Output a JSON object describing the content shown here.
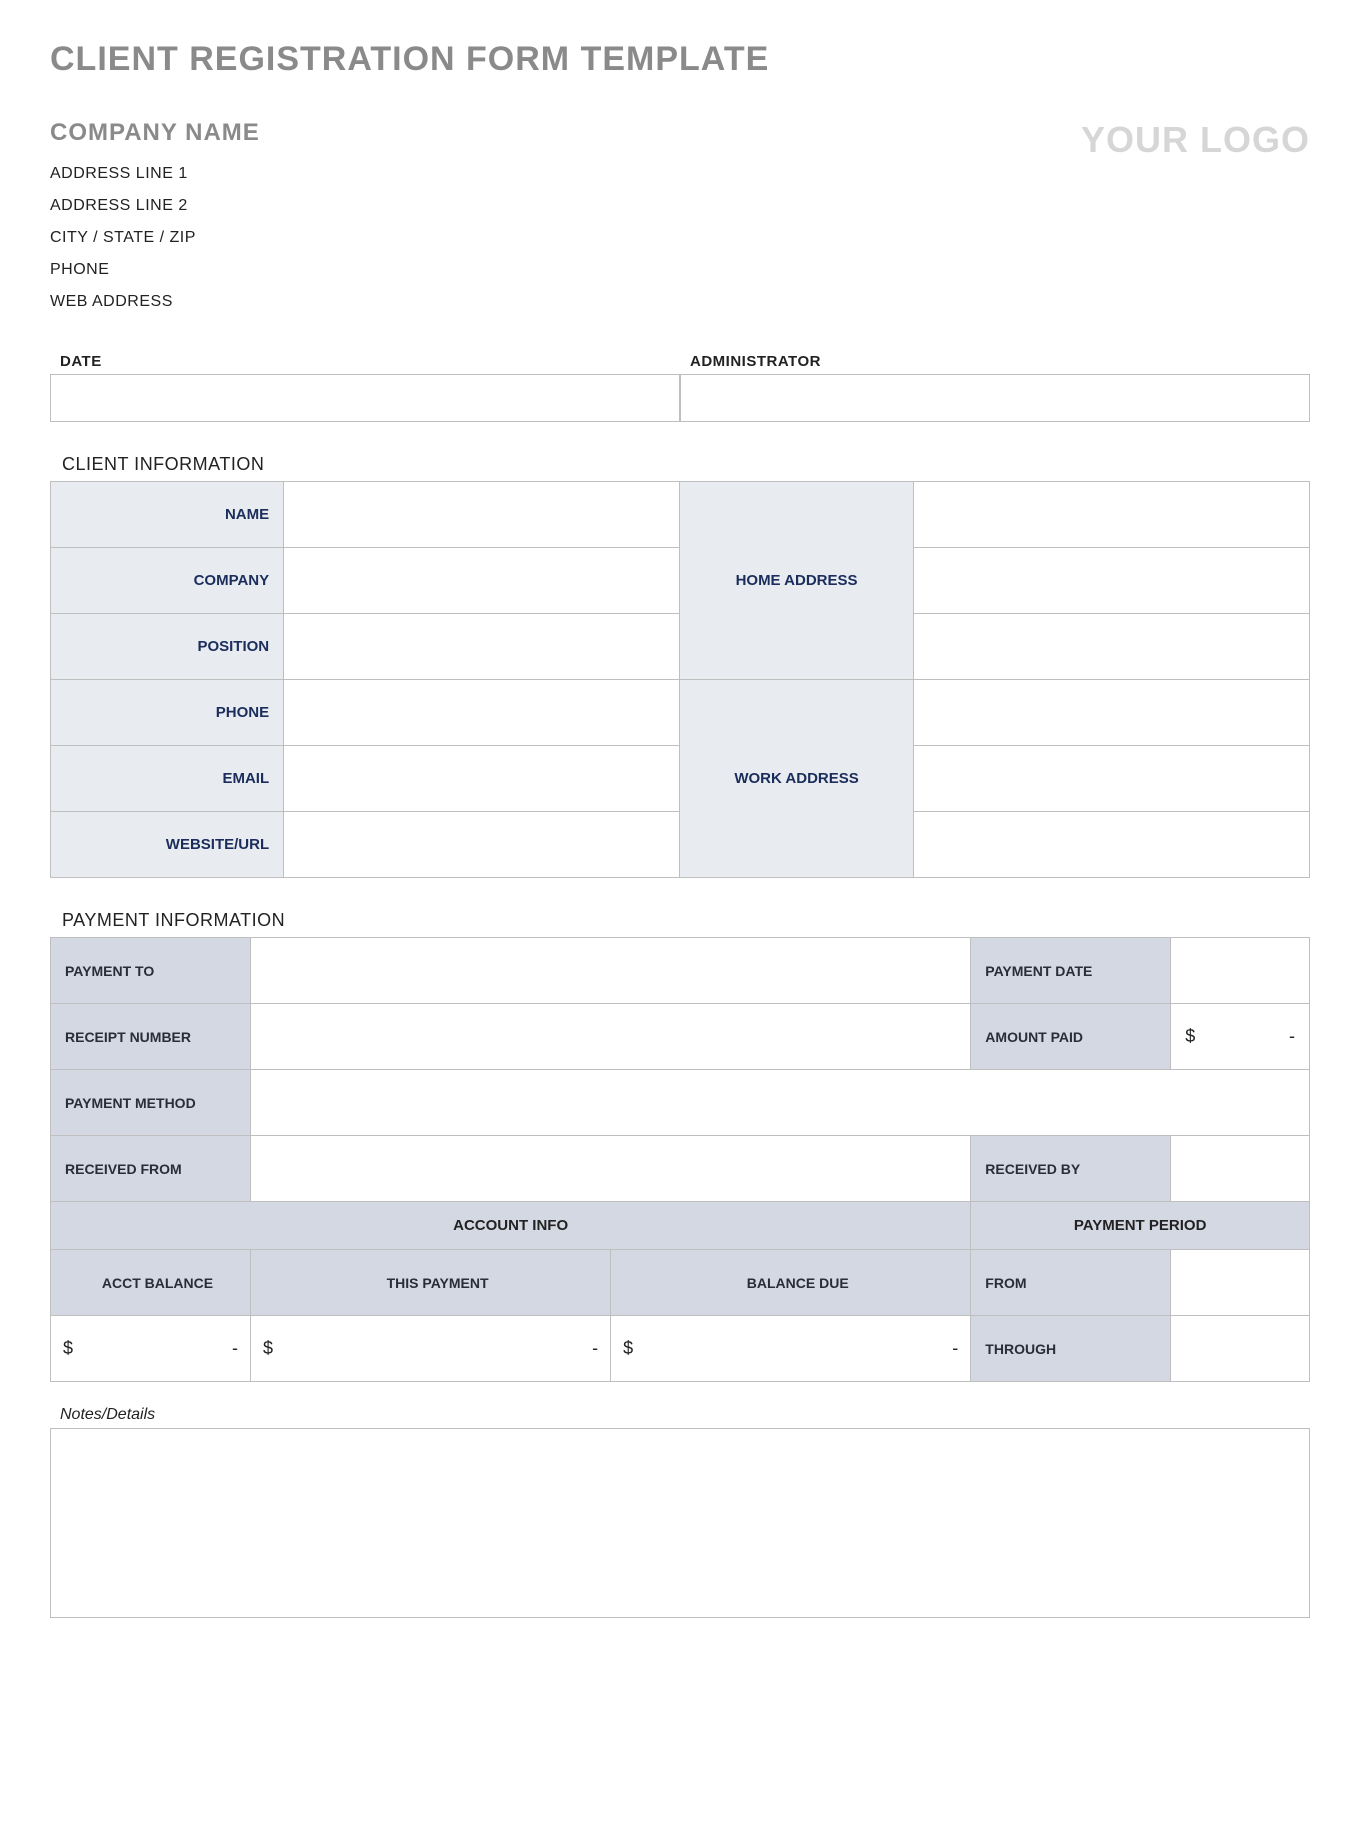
{
  "title": "CLIENT REGISTRATION FORM TEMPLATE",
  "company_name": "COMPANY NAME",
  "logo_text": "YOUR LOGO",
  "address": {
    "line1": "ADDRESS LINE 1",
    "line2": "ADDRESS LINE 2",
    "city_state_zip": "CITY / STATE / ZIP",
    "phone": "PHONE",
    "web": "WEB ADDRESS"
  },
  "date_label": "DATE",
  "administrator_label": "ADMINISTRATOR",
  "client_info": {
    "header": "CLIENT INFORMATION",
    "name_label": "NAME",
    "company_label": "COMPANY",
    "position_label": "POSITION",
    "phone_label": "PHONE",
    "email_label": "EMAIL",
    "website_label": "WEBSITE/URL",
    "home_address_label": "HOME ADDRESS",
    "work_address_label": "WORK ADDRESS"
  },
  "payment_info": {
    "header": "PAYMENT INFORMATION",
    "payment_to_label": "PAYMENT TO",
    "payment_date_label": "PAYMENT DATE",
    "receipt_number_label": "RECEIPT NUMBER",
    "amount_paid_label": "AMOUNT PAID",
    "payment_method_label": "PAYMENT METHOD",
    "received_from_label": "RECEIVED FROM",
    "received_by_label": "RECEIVED BY",
    "account_info_header": "ACCOUNT INFO",
    "payment_period_header": "PAYMENT PERIOD",
    "acct_balance_label": "ACCT BALANCE",
    "this_payment_label": "THIS PAYMENT",
    "balance_due_label": "BALANCE DUE",
    "from_label": "FROM",
    "through_label": "THROUGH",
    "currency_symbol": "$",
    "dash": "-"
  },
  "notes_label": "Notes/Details"
}
